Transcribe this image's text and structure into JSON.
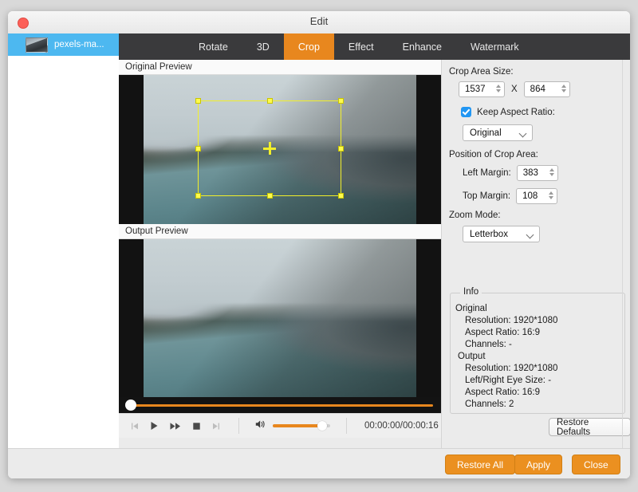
{
  "window": {
    "title": "Edit",
    "close_label": "Close window"
  },
  "sidebar": {
    "items": [
      {
        "name": "pexels-ma...",
        "icon": "video-thumbnail"
      }
    ]
  },
  "tabs": [
    {
      "label": "Rotate",
      "active": false
    },
    {
      "label": "3D",
      "active": false
    },
    {
      "label": "Crop",
      "active": true
    },
    {
      "label": "Effect",
      "active": false
    },
    {
      "label": "Enhance",
      "active": false
    },
    {
      "label": "Watermark",
      "active": false
    }
  ],
  "previews": {
    "original_label": "Original Preview",
    "output_label": "Output Preview"
  },
  "crop_panel": {
    "crop_area_size_label": "Crop Area Size:",
    "width_value": "1537",
    "separator": "X",
    "height_value": "864",
    "keep_aspect_ratio_label": "Keep Aspect Ratio:",
    "keep_aspect_ratio_checked": true,
    "aspect_ratio_value": "Original",
    "position_label": "Position of Crop Area:",
    "left_margin_label": "Left Margin:",
    "left_margin_value": "383",
    "top_margin_label": "Top Margin:",
    "top_margin_value": "108",
    "zoom_mode_label": "Zoom Mode:",
    "zoom_mode_value": "Letterbox"
  },
  "info": {
    "legend": "Info",
    "original_header": "Original",
    "original_lines": [
      "Resolution: 1920*1080",
      "Aspect Ratio: 16:9",
      "Channels: -"
    ],
    "output_header": "Output",
    "output_lines": [
      "Resolution: 1920*1080",
      "Left/Right Eye Size: -",
      "Aspect Ratio: 16:9",
      "Channels: 2"
    ],
    "restore_defaults_label": "Restore Defaults"
  },
  "transport": {
    "prev_icon": "skip-previous-icon",
    "play_icon": "play-icon",
    "forward_icon": "fast-forward-icon",
    "stop_icon": "stop-icon",
    "next_icon": "skip-next-icon",
    "volume_icon": "speaker-icon",
    "time_display": "00:00:00/00:00:16"
  },
  "footer": {
    "restore_all_label": "Restore All",
    "apply_label": "Apply",
    "close_label": "Close"
  },
  "colors": {
    "accent_orange": "#e8871e",
    "button_orange": "#eb9020",
    "tabbar_dark": "#3a3a3c",
    "selection_blue": "#4db8f0",
    "checkbox_blue": "#2196f3",
    "crop_outline_yellow": "#f2ef2a"
  }
}
